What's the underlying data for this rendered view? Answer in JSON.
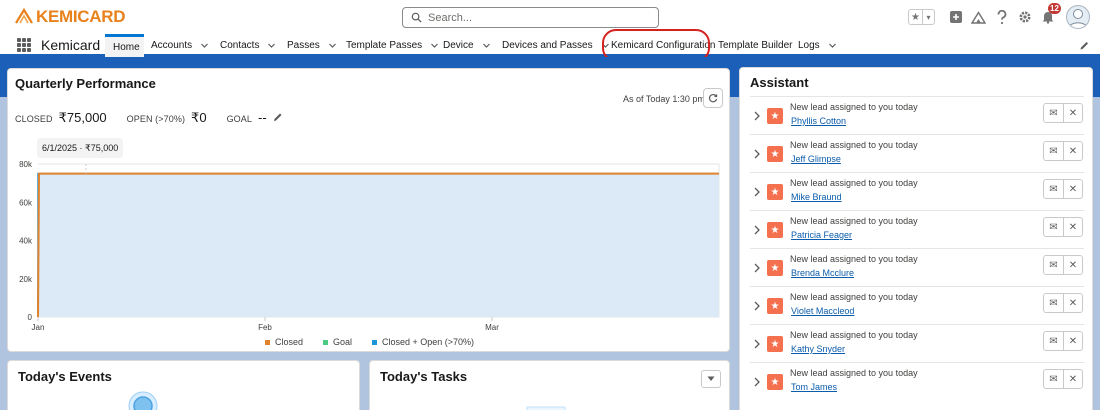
{
  "header": {
    "logo_text": "KEMICARD",
    "search_placeholder": "Search...",
    "notification_count": "12"
  },
  "nav": {
    "app_name": "Kemicard",
    "tabs": [
      {
        "label": "Home",
        "active": true,
        "dropdown": false
      },
      {
        "label": "Accounts",
        "dropdown": true
      },
      {
        "label": "Contacts",
        "dropdown": true
      },
      {
        "label": "Passes",
        "dropdown": true
      },
      {
        "label": "Template Passes",
        "dropdown": true
      },
      {
        "label": "Device",
        "dropdown": true
      },
      {
        "label": "Devices and Passes",
        "dropdown": true
      },
      {
        "label": "Kemicard Configuration",
        "dropdown": false,
        "highlighted": true
      },
      {
        "label": "Template Builder",
        "dropdown": false
      },
      {
        "label": "Logs",
        "dropdown": true
      }
    ]
  },
  "performance": {
    "title": "Quarterly Performance",
    "closed_label": "CLOSED",
    "closed_value": "₹75,000",
    "open_label": "OPEN (>70%)",
    "open_value": "₹0",
    "goal_label": "GOAL",
    "goal_value": "--",
    "as_of": "As of Today 1:30 pm",
    "tooltip": "6/1/2025 · ₹75,000"
  },
  "chart_data": {
    "type": "line",
    "x_labels": [
      "Jan",
      "Feb",
      "Mar"
    ],
    "y_ticks": [
      "0",
      "20k",
      "40k",
      "60k",
      "80k"
    ],
    "ylim": [
      0,
      80000
    ],
    "series": [
      {
        "name": "Closed",
        "color": "#e0822c",
        "values": [
          75000,
          75000,
          75000
        ]
      },
      {
        "name": "Goal",
        "color": "#4bca81",
        "values": []
      },
      {
        "name": "Closed + Open (>70%)",
        "color": "#1b96d8",
        "values": [
          75000,
          75000,
          75000
        ]
      }
    ]
  },
  "events": {
    "title": "Today's Events"
  },
  "tasks": {
    "title": "Today's Tasks"
  },
  "assistant": {
    "title": "Assistant",
    "items": [
      {
        "text": "New lead assigned to you today",
        "name": "Phyllis Cotton"
      },
      {
        "text": "New lead assigned to you today",
        "name": "Jeff Glimpse"
      },
      {
        "text": "New lead assigned to you today",
        "name": "Mike Braund"
      },
      {
        "text": "New lead assigned to you today",
        "name": "Patricia Feager"
      },
      {
        "text": "New lead assigned to you today",
        "name": "Brenda Mcclure"
      },
      {
        "text": "New lead assigned to you today",
        "name": "Violet Maccleod"
      },
      {
        "text": "New lead assigned to you today",
        "name": "Kathy Snyder"
      },
      {
        "text": "New lead assigned to you today",
        "name": "Tom James"
      }
    ]
  }
}
